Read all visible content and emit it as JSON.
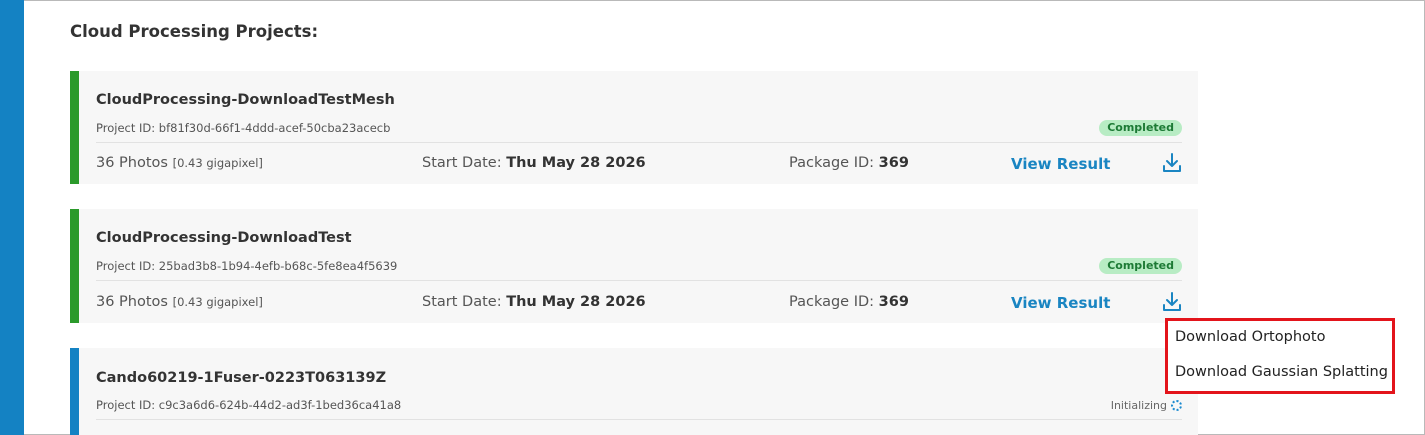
{
  "section_title": "Cloud Processing Projects:",
  "projects": [
    {
      "name": "CloudProcessing-DownloadTestMesh",
      "project_id_label": "Project ID:",
      "project_id": "bf81f30d-66f1-4ddd-acef-50cba23acecb",
      "status": "Completed",
      "accent_color": "#2b9a2b",
      "photos": "36 Photos",
      "gigapixel": "[0.43 gigapixel]",
      "start_date_label": "Start Date:",
      "start_date": "Thu May 28 2026",
      "package_label": "Package ID:",
      "package_id": "369",
      "view_result": "View Result",
      "download_icon": "download-icon"
    },
    {
      "name": "CloudProcessing-DownloadTest",
      "project_id_label": "Project ID:",
      "project_id": "25bad3b8-1b94-4efb-b68c-5fe8ea4f5639",
      "status": "Completed",
      "accent_color": "#2b9a2b",
      "photos": "36 Photos",
      "gigapixel": "[0.43 gigapixel]",
      "start_date_label": "Start Date:",
      "start_date": "Thu May 28 2026",
      "package_label": "Package ID:",
      "package_id": "369",
      "view_result": "View Result",
      "download_icon": "download-icon"
    },
    {
      "name": "Cando60219-1Fuser-0223T063139Z",
      "project_id_label": "Project ID:",
      "project_id": "c9c3a6d6-624b-44d2-ad3f-1bed36ca41a8",
      "status": "Initializing",
      "accent_color": "#1482c3"
    }
  ],
  "download_menu": {
    "items": [
      "Download Ortophoto",
      "Download Gaussian Splatting"
    ],
    "highlight_color": "#e3141b"
  },
  "colors": {
    "sidebar": "#1482c3",
    "link": "#1a85c2",
    "completed_bg": "#b8ecc4",
    "completed_text": "#1d7a35"
  }
}
